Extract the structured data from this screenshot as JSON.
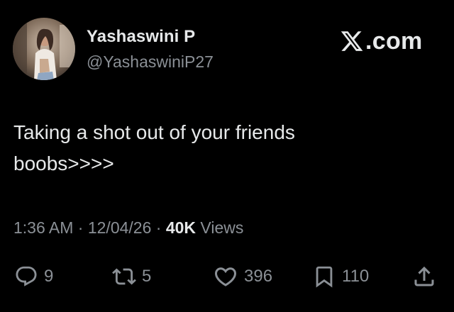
{
  "user": {
    "display_name": "Yashaswini P",
    "handle": "@YashaswiniP27",
    "avatar_icon": "profile-photo"
  },
  "brand": {
    "logo_icon": "x-logo-icon",
    "suffix": ".com"
  },
  "tweet": {
    "lines": [
      "Taking a shot out of your friends",
      "boobs>>>>"
    ]
  },
  "meta": {
    "time": "1:36 AM",
    "separator": " · ",
    "date": "12/04/26",
    "views_count": "40K",
    "views_label": "Views"
  },
  "actions": {
    "replies": {
      "icon": "reply-icon",
      "count": "9"
    },
    "reposts": {
      "icon": "repost-icon",
      "count": "5"
    },
    "likes": {
      "icon": "heart-icon",
      "count": "396"
    },
    "bookmarks": {
      "icon": "bookmark-icon",
      "count": "110"
    },
    "share": {
      "icon": "share-icon"
    }
  },
  "colors": {
    "background": "#000000",
    "primary_text": "#e7e9ea",
    "secondary_text": "#8b9096"
  }
}
